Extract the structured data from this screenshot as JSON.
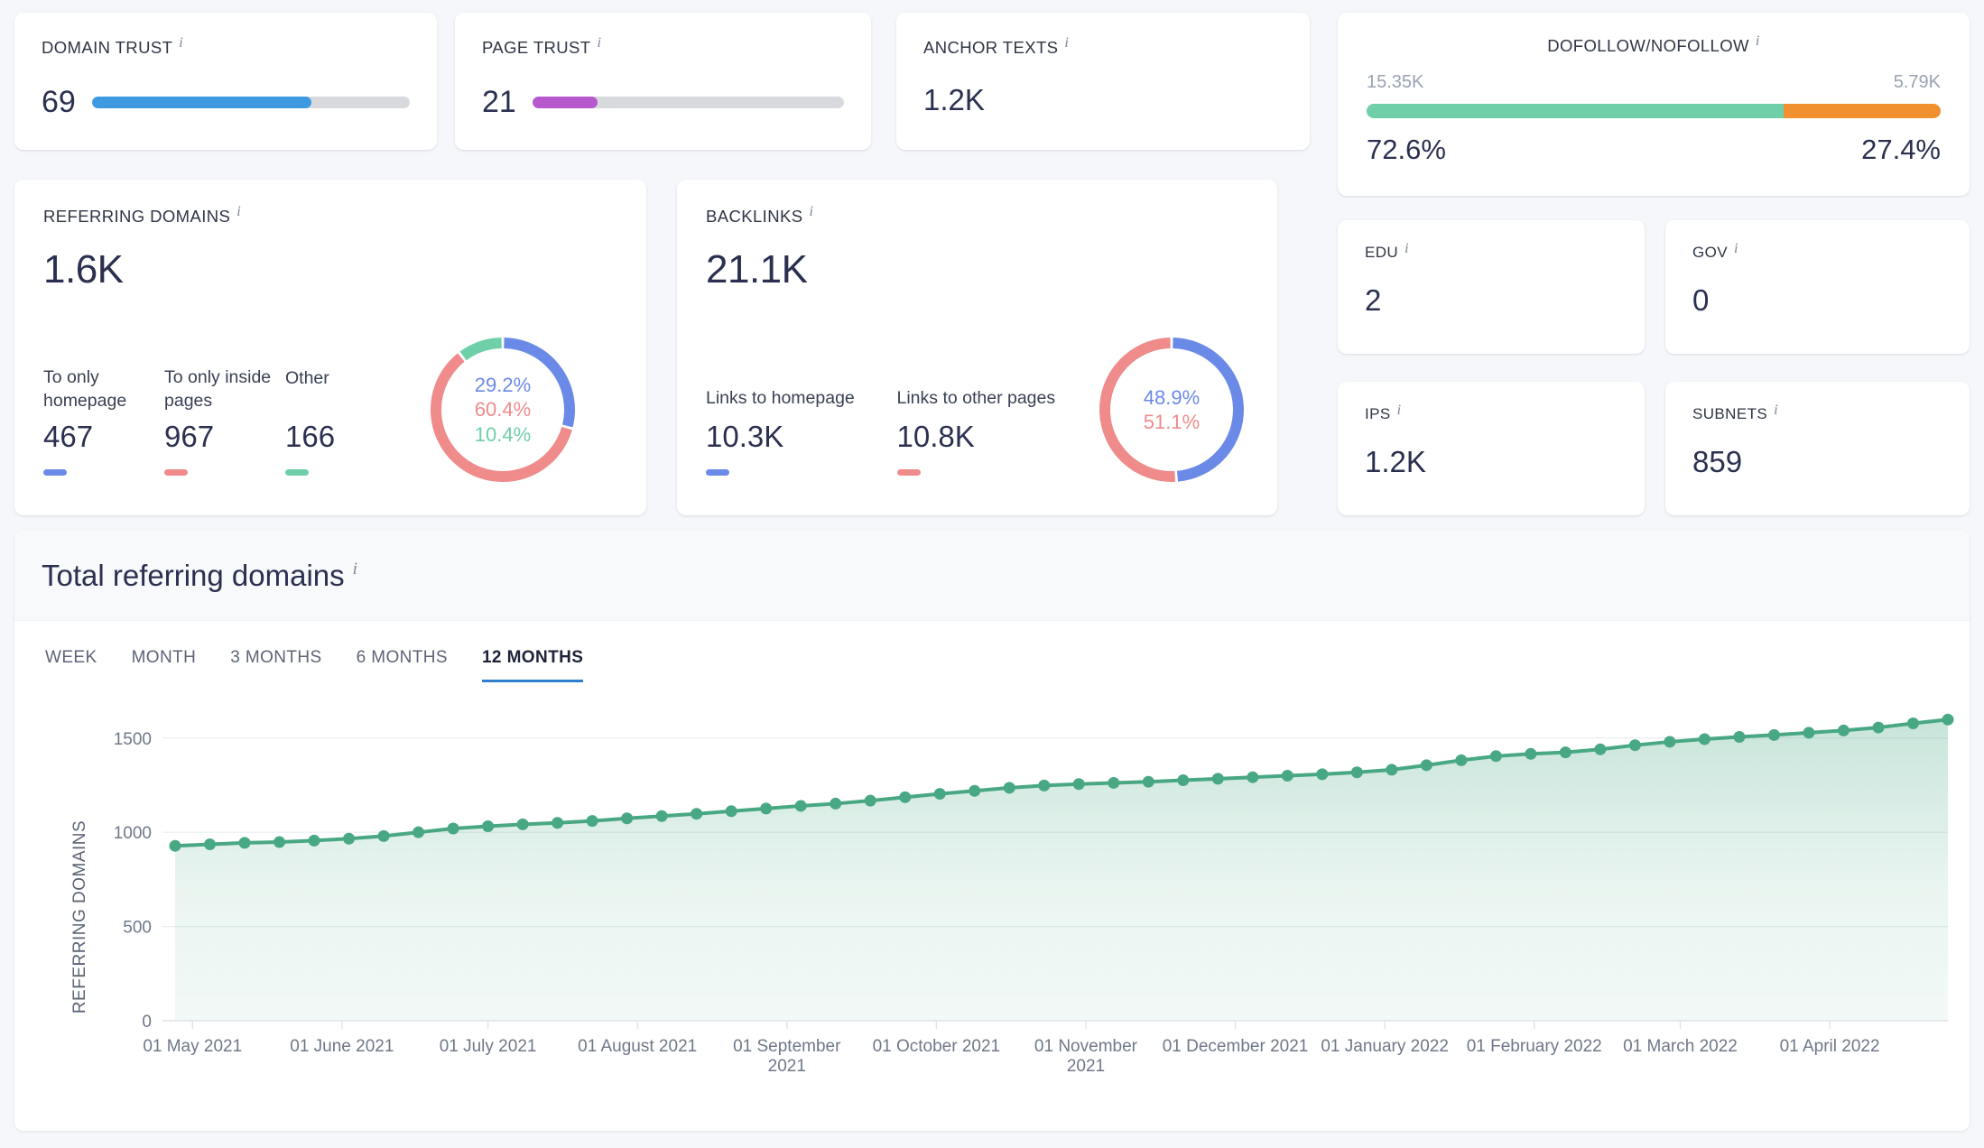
{
  "colors": {
    "blue": "#6b8ae8",
    "salmon": "#ef8b8b",
    "green": "#6fcfa8",
    "line_green": "#49a884",
    "orange": "#f0902f",
    "trust_blue": "#3d9ae0",
    "purple": "#b659ce",
    "track": "#d8dade",
    "accent_tab": "#2f7fd1"
  },
  "domain_trust": {
    "label": "DOMAIN TRUST",
    "info": "i",
    "value": "69",
    "percent": 69
  },
  "page_trust": {
    "label": "PAGE TRUST",
    "info": "i",
    "value": "21",
    "percent": 21
  },
  "anchor_texts": {
    "label": "ANCHOR TEXTS",
    "info": "i",
    "value": "1.2K"
  },
  "dofollow": {
    "label": "DOFOLLOW/NOFOLLOW",
    "info": "i",
    "left_count": "15.35K",
    "right_count": "5.79K",
    "left_percent_label": "72.6%",
    "right_percent_label": "27.4%",
    "left_percent": 72.6,
    "right_percent": 27.4
  },
  "referring_domains": {
    "label": "REFERRING DOMAINS",
    "info": "i",
    "total": "1.6K",
    "breakdown": [
      {
        "name": "To only homepage",
        "value": "467",
        "color": "#6b8ae8",
        "percent_label": "29.2%",
        "percent": 29.2
      },
      {
        "name": "To only inside pages",
        "value": "967",
        "color": "#ef8b8b",
        "percent_label": "60.4%",
        "percent": 60.4
      },
      {
        "name": "Other",
        "value": "166",
        "color": "#6fcfa8",
        "percent_label": "10.4%",
        "percent": 10.4
      }
    ]
  },
  "backlinks": {
    "label": "BACKLINKS",
    "info": "i",
    "total": "21.1K",
    "breakdown": [
      {
        "name": "Links to homepage",
        "value": "10.3K",
        "color": "#6b8ae8",
        "percent_label": "48.9%",
        "percent": 48.9
      },
      {
        "name": "Links to other pages",
        "value": "10.8K",
        "color": "#ef8b8b",
        "percent_label": "51.1%",
        "percent": 51.1
      }
    ]
  },
  "small_stats": [
    {
      "label": "EDU",
      "info": "i",
      "value": "2"
    },
    {
      "label": "GOV",
      "info": "i",
      "value": "0"
    },
    {
      "label": "IPS",
      "info": "i",
      "value": "1.2K"
    },
    {
      "label": "SUBNETS",
      "info": "i",
      "value": "859"
    }
  ],
  "chart_section": {
    "title": "Total referring domains",
    "info": "i",
    "tabs": [
      {
        "label": "WEEK",
        "active": false
      },
      {
        "label": "MONTH",
        "active": false
      },
      {
        "label": "3 MONTHS",
        "active": false
      },
      {
        "label": "6 MONTHS",
        "active": false
      },
      {
        "label": "12 MONTHS",
        "active": true
      }
    ]
  },
  "chart_data": {
    "type": "area",
    "title": "Total referring domains",
    "xlabel": "",
    "ylabel": "REFERRING DOMAINS",
    "ylim": [
      0,
      1700
    ],
    "yticks": [
      0,
      500,
      1000,
      1500
    ],
    "ytick_labels": [
      "0",
      "500",
      "1000",
      "1500"
    ],
    "grid": true,
    "legend": null,
    "line_color": "#49a884",
    "area_fill": "#d9eee4",
    "xtick_labels": [
      "01 May 2021",
      "01 June 2021",
      "01 July 2021",
      "01 August 2021",
      "01 September 2021",
      "01 October 2021",
      "01 November 2021",
      "01 December 2021",
      "01 January 2022",
      "01 February 2022",
      "01 March 2022",
      "01 April 2022"
    ],
    "xtick_positions": [
      0.5,
      4.8,
      9.0,
      13.3,
      17.6,
      21.9,
      26.2,
      30.5,
      34.8,
      39.1,
      43.3,
      47.6
    ],
    "series": [
      {
        "name": "Referring domains",
        "values": [
          928,
          936,
          944,
          948,
          956,
          966,
          980,
          1000,
          1020,
          1032,
          1042,
          1050,
          1060,
          1074,
          1086,
          1098,
          1112,
          1126,
          1140,
          1152,
          1168,
          1186,
          1204,
          1220,
          1236,
          1248,
          1256,
          1262,
          1268,
          1276,
          1284,
          1292,
          1300,
          1308,
          1318,
          1332,
          1356,
          1382,
          1404,
          1416,
          1424,
          1440,
          1462,
          1480,
          1494,
          1506,
          1516,
          1528,
          1540,
          1556,
          1578,
          1598
        ]
      }
    ]
  }
}
